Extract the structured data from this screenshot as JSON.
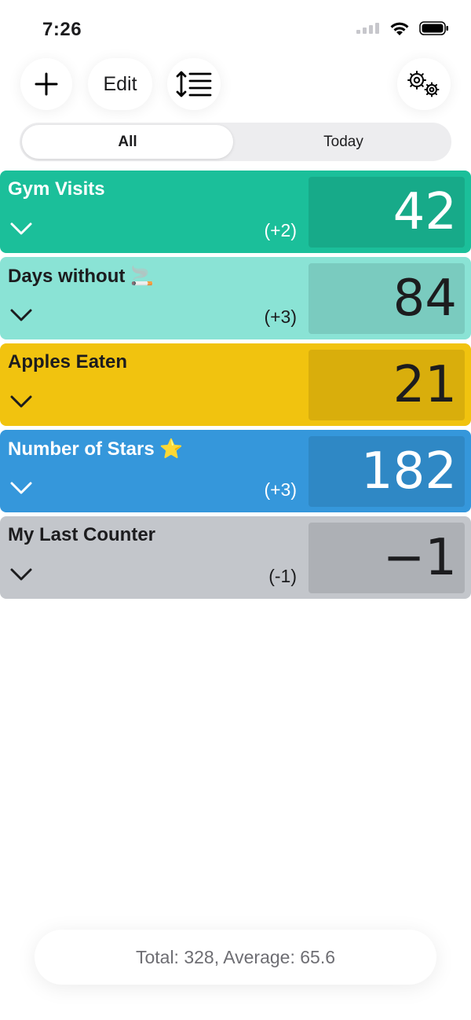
{
  "status_bar": {
    "time": "7:26"
  },
  "toolbar": {
    "add_icon": "plus-icon",
    "edit_label": "Edit",
    "sort_icon": "sort-list-icon",
    "settings_icon": "gears-icon"
  },
  "segmented": {
    "all_label": "All",
    "today_label": "Today",
    "selected": "All"
  },
  "counters": [
    {
      "name": "Gym Visits",
      "value": "42",
      "delta": "(+2)",
      "bg": "#1bbf9a",
      "box": "#17aa89",
      "text": "#ffffff"
    },
    {
      "name": "Days without 🚬",
      "value": "84",
      "delta": "(+3)",
      "bg": "#8ae3d5",
      "box": "#7acbbf",
      "text": "#1c1c1e"
    },
    {
      "name": "Apples Eaten",
      "value": "21",
      "delta": "",
      "bg": "#f1c30f",
      "box": "#d9ae0c",
      "text": "#1c1c1e"
    },
    {
      "name": "Number of Stars ⭐",
      "value": "182",
      "delta": "(+3)",
      "bg": "#3597db",
      "box": "#2f88c5",
      "text": "#ffffff"
    },
    {
      "name": "My Last Counter",
      "value": "−1",
      "delta": "(-1)",
      "bg": "#c3c6cb",
      "box": "#adb0b5",
      "text": "#1c1c1e"
    }
  ],
  "footer": {
    "summary": "Total: 328, Average: 65.6"
  }
}
